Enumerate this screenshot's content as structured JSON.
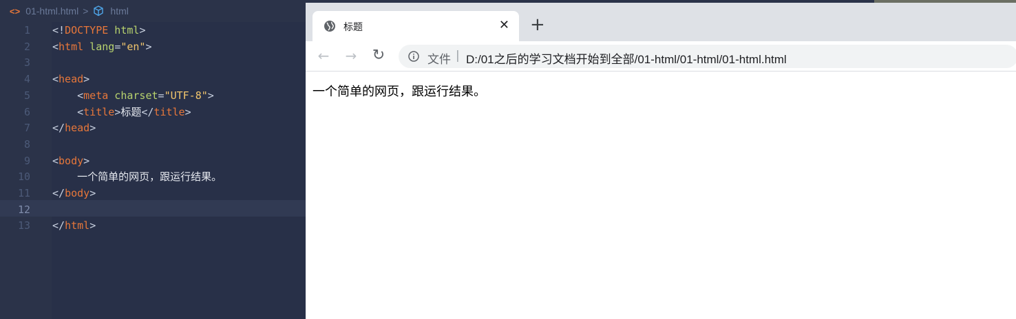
{
  "editor": {
    "breadcrumb": {
      "file_icon": "<>",
      "file": "01-html.html",
      "separator": ">",
      "symbol": "html"
    },
    "active_line": 12,
    "lines": [
      {
        "n": "1",
        "t": [
          "<!",
          "DOCTYPE",
          " html",
          ">"
        ]
      },
      {
        "n": "2",
        "t": [
          "<",
          "html",
          " lang",
          "=",
          "\"en\"",
          ">"
        ]
      },
      {
        "n": "3",
        "t": []
      },
      {
        "n": "4",
        "t": [
          "<",
          "head",
          ">"
        ]
      },
      {
        "n": "5",
        "t": [
          "    <",
          "meta",
          " charset",
          "=",
          "\"UTF-8\"",
          ">"
        ]
      },
      {
        "n": "6",
        "t": [
          "    <",
          "title",
          ">",
          "标题",
          "</",
          "title",
          ">"
        ]
      },
      {
        "n": "7",
        "t": [
          "</",
          "head",
          ">"
        ]
      },
      {
        "n": "8",
        "t": []
      },
      {
        "n": "9",
        "t": [
          "<",
          "body",
          ">"
        ]
      },
      {
        "n": "10",
        "t": [
          "    一个简单的网页，跟运行结果。"
        ]
      },
      {
        "n": "11",
        "t": [
          "</",
          "body",
          ">"
        ]
      },
      {
        "n": "12",
        "t": []
      },
      {
        "n": "13",
        "t": [
          "</",
          "html",
          ">"
        ]
      }
    ]
  },
  "browser": {
    "tab": {
      "title": "标题",
      "close": "✕"
    },
    "new_tab": "+",
    "nav": {
      "back": "←",
      "forward": "→",
      "reload": "↻"
    },
    "omnibox": {
      "scheme_label": "文件",
      "separator": "|",
      "url": "D:/01之后的学习文档开始到全部/01-html/01-html/01-html.html"
    },
    "page": {
      "body_text": "一个简单的网页，跟运行结果。"
    }
  },
  "colors": {
    "editor_bg": "#2b3349",
    "tag": "#e8773a",
    "attr": "#b8d36e",
    "string": "#f2c66d",
    "tab_strip": "#dee1e6"
  },
  "icons": [
    "html-file-icon",
    "cube-icon",
    "globe-icon",
    "close-icon",
    "plus-icon",
    "back-arrow-icon",
    "forward-arrow-icon",
    "reload-icon",
    "info-icon"
  ]
}
